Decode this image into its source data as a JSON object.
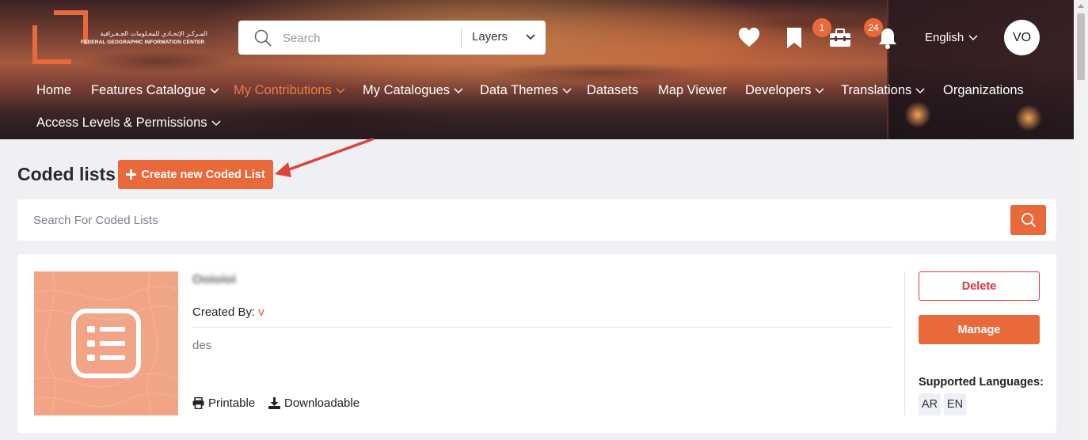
{
  "logo": {
    "arabic_text": "المـركـز الإتحـادي للمعـلومات الجـغـرافية",
    "english_text": "FEDERAL GEOGRAPHIC INFORMATION CENTER"
  },
  "header": {
    "search_placeholder": "Search",
    "layers_label": "Layers",
    "icons": [
      "heart-icon",
      "bookmark-icon",
      "toolbox-icon",
      "bell-icon"
    ],
    "toolbox_badge": "1",
    "notifications_badge": "24",
    "language": "English",
    "avatar_initials": "VO"
  },
  "nav": {
    "items": [
      {
        "label": "Home",
        "dropdown": false
      },
      {
        "label": "Features Catalogue",
        "dropdown": true
      },
      {
        "label": "My Contributions",
        "dropdown": true,
        "active": true
      },
      {
        "label": "My Catalogues",
        "dropdown": true
      },
      {
        "label": "Data Themes",
        "dropdown": true
      },
      {
        "label": "Datasets",
        "dropdown": false
      },
      {
        "label": "Map Viewer",
        "dropdown": false
      },
      {
        "label": "Developers",
        "dropdown": true
      },
      {
        "label": "Translations",
        "dropdown": true
      },
      {
        "label": "Organizations",
        "dropdown": false
      },
      {
        "label": "Access Levels & Permissions",
        "dropdown": true
      }
    ]
  },
  "main": {
    "title": "Coded lists",
    "create_button": "Create new Coded List",
    "search_placeholder": "Search For Coded Lists"
  },
  "card": {
    "title": "Ooioioi",
    "created_by_label": "Created By:",
    "created_by_user": "v",
    "description": "des",
    "printable_label": "Printable",
    "downloadable_label": "Downloadable",
    "delete_label": "Delete",
    "manage_label": "Manage",
    "supported_languages_label": "Supported Languages:",
    "languages": [
      "AR",
      "EN"
    ]
  },
  "colors": {
    "accent": "#e8693a",
    "active_nav": "#f07b45",
    "danger": "#d9363e",
    "page_bg": "#eef0f3"
  }
}
